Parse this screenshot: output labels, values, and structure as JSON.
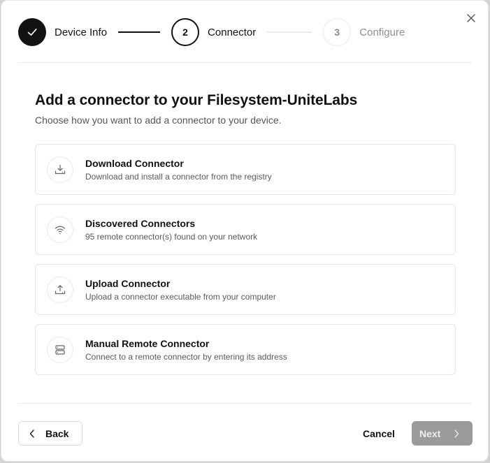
{
  "stepper": {
    "steps": [
      {
        "number": "",
        "label": "Device Info",
        "state": "done",
        "icon": "check-icon"
      },
      {
        "number": "2",
        "label": "Connector",
        "state": "current"
      },
      {
        "number": "3",
        "label": "Configure",
        "state": "upcoming"
      }
    ]
  },
  "header": {
    "title": "Add a connector to your Filesystem-UniteLabs",
    "subtitle": "Choose how you want to add a connector to your device."
  },
  "options": [
    {
      "title": "Download Connector",
      "description": "Download and install a connector from the registry",
      "icon": "download-icon"
    },
    {
      "title": "Discovered Connectors",
      "description": "95 remote connector(s) found on your network",
      "icon": "wifi-icon"
    },
    {
      "title": "Upload Connector",
      "description": "Upload a connector executable from your computer",
      "icon": "upload-icon"
    },
    {
      "title": "Manual Remote Connector",
      "description": "Connect to a remote connector by entering its address",
      "icon": "server-icon"
    }
  ],
  "footer": {
    "back_label": "Back",
    "cancel_label": "Cancel",
    "next_label": "Next"
  },
  "colors": {
    "primary": "#121212",
    "disabled_button": "#9a9a9a",
    "border": "#e5e5e5"
  }
}
